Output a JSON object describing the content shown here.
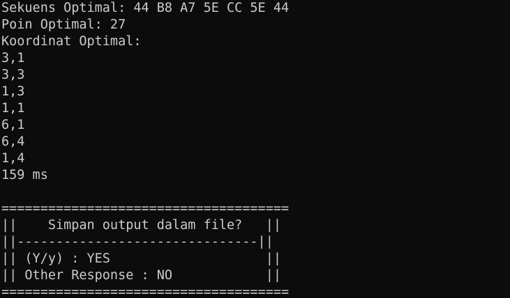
{
  "terminal": {
    "result": {
      "sequence_line": "Sekuens Optimal: 44 B8 A7 5E CC 5E 44",
      "points_line": "Poin Optimal: 27",
      "coords_header": "Koordinat Optimal:",
      "coordinates": [
        "3,1",
        "3,3",
        "1,3",
        "1,1",
        "6,1",
        "6,4",
        "1,4"
      ],
      "time": "159 ms"
    },
    "prompt_box": {
      "border_top": "=====================================",
      "title_line": "||    Simpan output dalam file?   ||",
      "separator": "||-------------------------------||",
      "option_yes": "|| (Y/y) : YES                    ||",
      "option_no": "|| Other Response : NO            ||",
      "border_bottom": "====================================="
    },
    "colors": {
      "background": "#0c0c0c",
      "foreground": "#cccccc"
    }
  }
}
